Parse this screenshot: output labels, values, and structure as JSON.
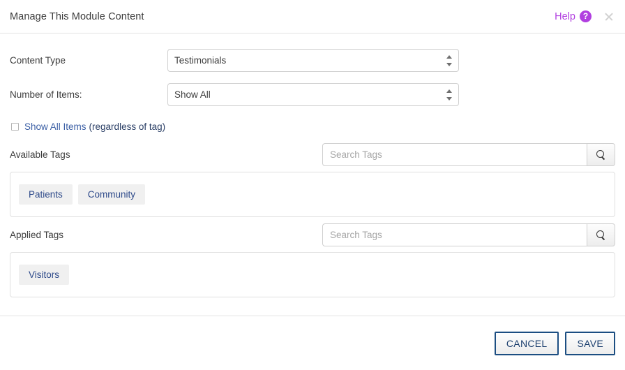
{
  "header": {
    "title": "Manage This Module Content",
    "help_label": "Help",
    "help_badge": "?",
    "close_icon": "close-icon",
    "accent_purple": "#b13fe0"
  },
  "form": {
    "content_type": {
      "label": "Content Type",
      "value": "Testimonials"
    },
    "number_of_items": {
      "label": "Number of Items:",
      "value": "Show All"
    },
    "show_all_items": {
      "checked": false,
      "link_text": "Show All Items",
      "tail_text": "(regardless of tag)"
    }
  },
  "available_tags": {
    "label": "Available Tags",
    "search_placeholder": "Search Tags",
    "search_value": "",
    "search_icon": "search-icon",
    "tags": [
      "Patients",
      "Community"
    ]
  },
  "applied_tags": {
    "label": "Applied Tags",
    "search_placeholder": "Search Tags",
    "search_value": "",
    "search_icon": "search-icon",
    "tags": [
      "Visitors"
    ]
  },
  "footer": {
    "cancel_label": "CANCEL",
    "save_label": "SAVE",
    "button_border_color": "#1c4e82"
  }
}
